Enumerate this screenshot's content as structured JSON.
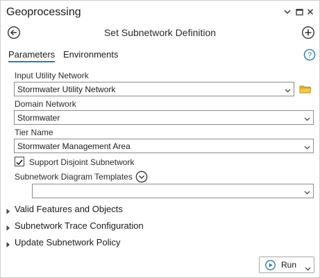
{
  "window": {
    "title": "Geoprocessing",
    "controls": [
      "chevron-down-icon",
      "maximize-icon",
      "close-icon"
    ]
  },
  "tool": {
    "heading": "Set Subnetwork Definition",
    "back_icon": "back-arrow-icon",
    "add_icon": "add-icon"
  },
  "tabs": [
    {
      "label": "Parameters",
      "active": true
    },
    {
      "label": "Environments",
      "active": false
    }
  ],
  "help_icon": "help-icon",
  "params": {
    "input_utility_network": {
      "label": "Input Utility Network",
      "value": "Stormwater Utility Network"
    },
    "domain_network": {
      "label": "Domain Network",
      "value": "Stormwater"
    },
    "tier_name": {
      "label": "Tier Name",
      "value": "Stormwater Management Area"
    },
    "support_disjoint": {
      "label": "Support Disjoint Subnetwork",
      "checked": true
    },
    "diagram_templates": {
      "label": "Subnetwork Diagram Templates",
      "value": ""
    }
  },
  "groups": [
    {
      "label": "Valid Features and Objects"
    },
    {
      "label": "Subnetwork Trace Configuration"
    },
    {
      "label": "Update Subnetwork Policy"
    }
  ],
  "run_button": {
    "label": "Run"
  },
  "colors": {
    "accent": "#2a7ab0",
    "folder": "#e3b23c",
    "border": "#8a8a8a"
  }
}
